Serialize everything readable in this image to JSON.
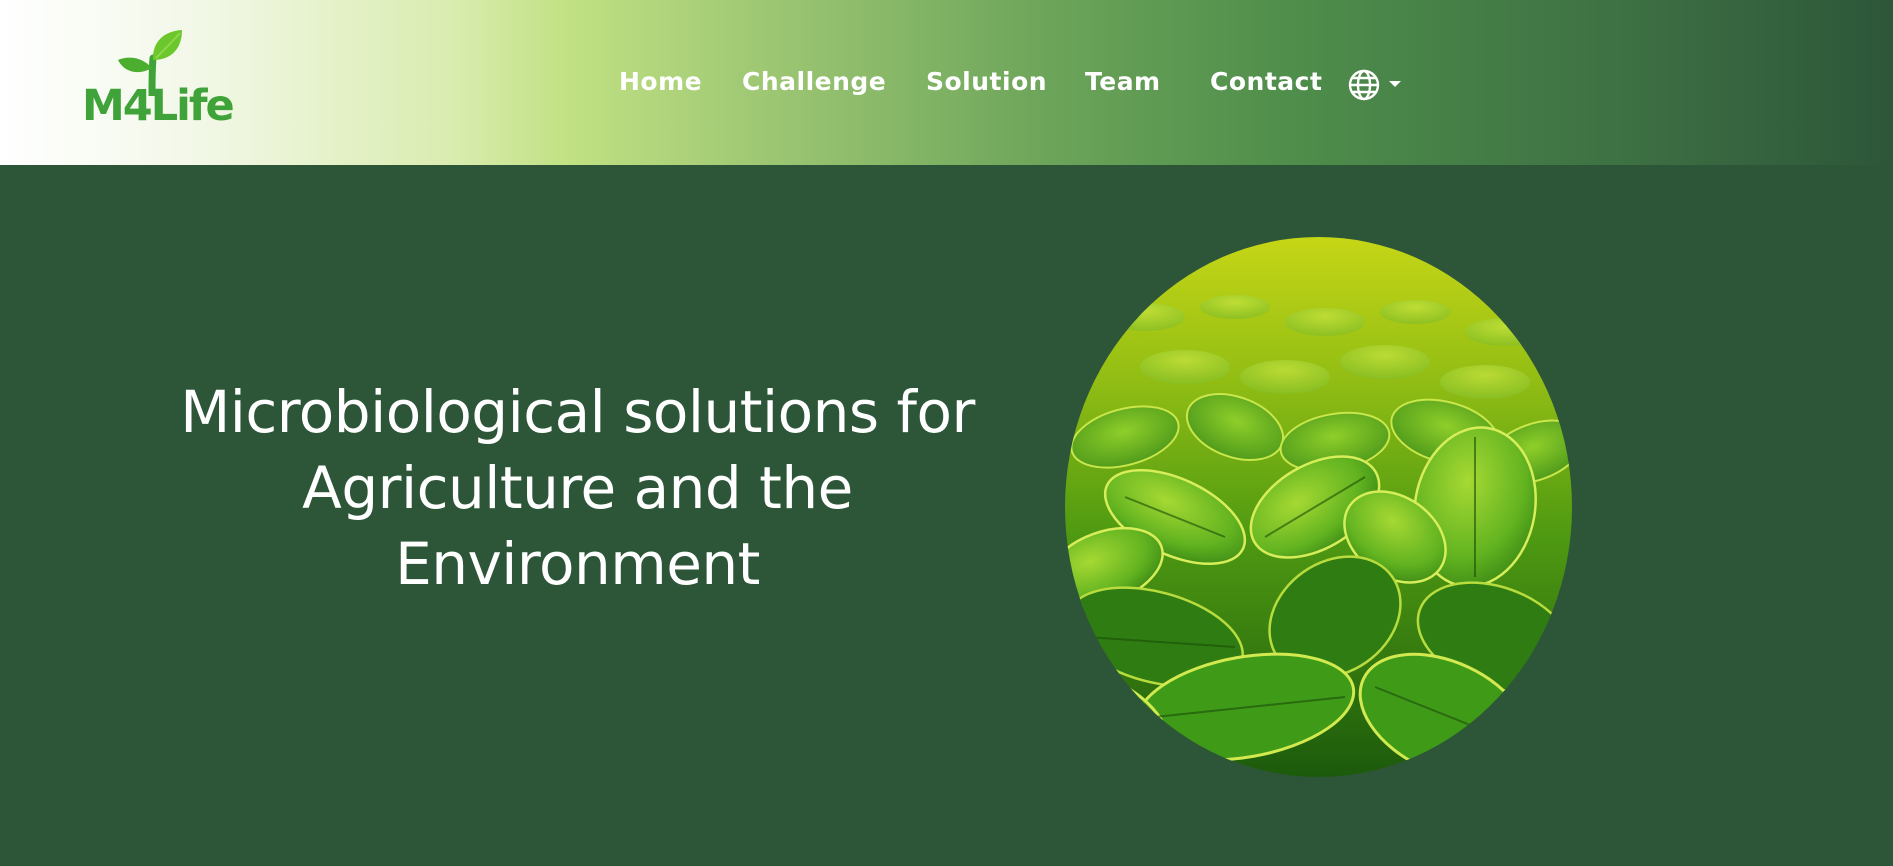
{
  "brand": {
    "name": "M4Life",
    "logo_icon": "sprout-icon",
    "color": "#3fa33a"
  },
  "nav": {
    "items": [
      {
        "label": "Home"
      },
      {
        "label": "Challenge"
      },
      {
        "label": "Solution"
      },
      {
        "label": "Team"
      },
      {
        "label": "Contact"
      }
    ],
    "language_icon": "globe-icon",
    "dropdown_icon": "caret-down-icon"
  },
  "hero": {
    "title": "Microbiological solutions for Agriculture and the Environment",
    "image": "soybean-leaves-field"
  },
  "colors": {
    "background": "#2d5639",
    "text": "#ffffff",
    "header_gradient_start": "#ffffff",
    "header_gradient_mid": "#c1e183",
    "header_gradient_end": "#2d5639"
  }
}
